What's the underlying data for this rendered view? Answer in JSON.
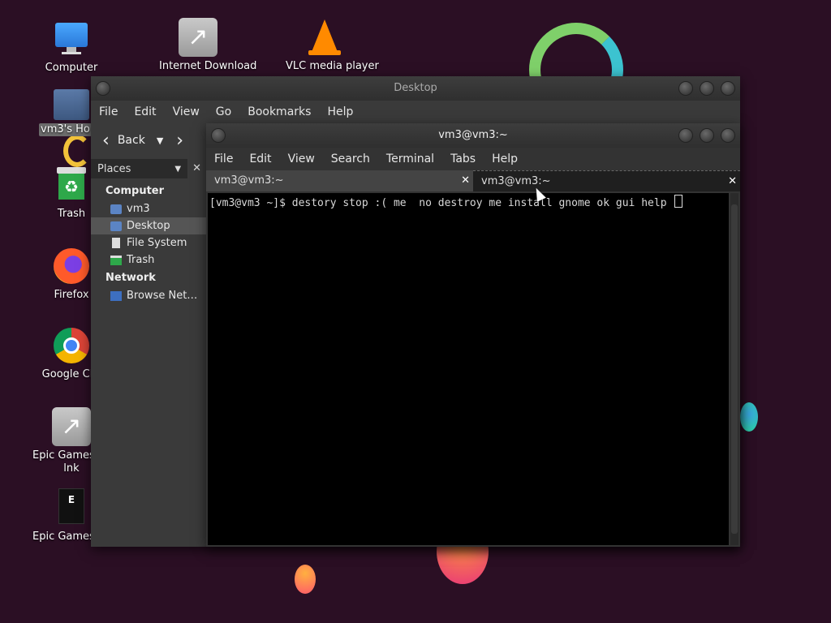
{
  "desktop_icons": [
    {
      "label": "Computer"
    },
    {
      "label": "Internet Download"
    },
    {
      "label": "VLC media player"
    },
    {
      "label": "vm3's Ho"
    },
    {
      "label": "Trash"
    },
    {
      "label": "Firefox"
    },
    {
      "label": "Google Chr"
    },
    {
      "label": "Epic Games La"
    },
    {
      "label": "lnk"
    },
    {
      "label": "Epic Games La"
    }
  ],
  "file_manager": {
    "title": "Desktop",
    "menu": [
      "File",
      "Edit",
      "View",
      "Go",
      "Bookmarks",
      "Help"
    ],
    "back_label": "Back",
    "places_label": "Places",
    "sidebar": {
      "computer_label": "Computer",
      "items": [
        "vm3",
        "Desktop",
        "File System",
        "Trash"
      ],
      "network_label": "Network",
      "network_items": [
        "Browse Net…"
      ]
    }
  },
  "terminal": {
    "title": "vm3@vm3:~",
    "menu": [
      "File",
      "Edit",
      "View",
      "Search",
      "Terminal",
      "Tabs",
      "Help"
    ],
    "tabs": [
      "vm3@vm3:~",
      "vm3@vm3:~"
    ],
    "line": "[vm3@vm3 ~]$ destory stop :( me  no destroy me install gnome ok gui help "
  }
}
